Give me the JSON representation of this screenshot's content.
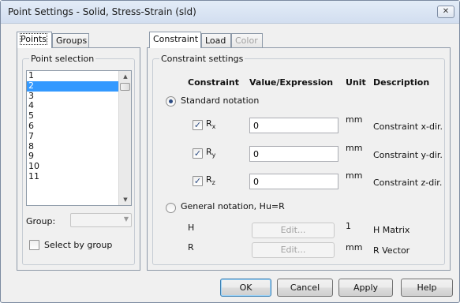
{
  "window": {
    "title": "Point Settings - Solid, Stress-Strain (sld)",
    "close_label": "✕"
  },
  "left_tabs": [
    {
      "label": "Points"
    },
    {
      "label": "Groups"
    }
  ],
  "point_selection": {
    "group_title": "Point selection",
    "items": [
      "1",
      "2",
      "3",
      "4",
      "5",
      "6",
      "7",
      "8",
      "9",
      "10",
      "11"
    ],
    "selected": "2"
  },
  "group": {
    "label": "Group:",
    "value": ""
  },
  "select_by_group": {
    "label": "Select by group",
    "checked": false
  },
  "right_tabs": [
    {
      "label": "Constraint"
    },
    {
      "label": "Load"
    },
    {
      "label": "Color",
      "disabled": true
    }
  ],
  "constraint_settings": {
    "group_title": "Constraint settings",
    "headers": {
      "constraint": "Constraint",
      "value": "Value/Expression",
      "unit": "Unit",
      "description": "Description"
    },
    "standard_notation": {
      "label": "Standard notation",
      "selected": true
    },
    "rows": [
      {
        "symbol": "R",
        "subscript": "x",
        "checked": true,
        "value": "0",
        "unit": "mm",
        "description": "Constraint x-dir."
      },
      {
        "symbol": "R",
        "subscript": "y",
        "checked": true,
        "value": "0",
        "unit": "mm",
        "description": "Constraint y-dir."
      },
      {
        "symbol": "R",
        "subscript": "z",
        "checked": true,
        "value": "0",
        "unit": "mm",
        "description": "Constraint z-dir."
      }
    ],
    "general_notation": {
      "label": "General notation, Hu=R",
      "selected": false
    },
    "general_rows": [
      {
        "symbol": "H",
        "button": "Edit...",
        "unit": "1",
        "description": "H Matrix"
      },
      {
        "symbol": "R",
        "button": "Edit...",
        "unit": "mm",
        "description": "R Vector"
      }
    ]
  },
  "buttons": {
    "ok": "OK",
    "cancel": "Cancel",
    "apply": "Apply",
    "help": "Help"
  },
  "icons": {
    "check": "✓",
    "scroll_up": "▲",
    "scroll_down": "▼",
    "combo_arrow": "▼"
  }
}
